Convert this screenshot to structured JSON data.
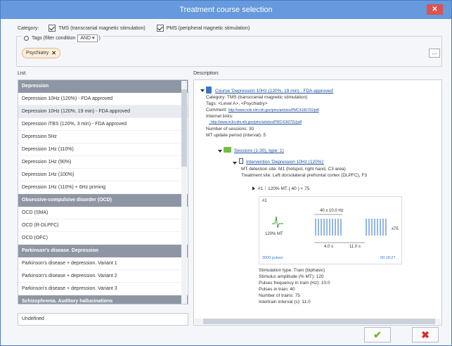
{
  "window": {
    "title": "Treatment course selection"
  },
  "category": {
    "label": "Category:",
    "tms_label": "TMS (transcranial magnetic stimulation)",
    "pms_label": "PMS (peripheral magnetic stimulation)"
  },
  "tags": {
    "label": "Tags (filter condition",
    "condition": "AND",
    "suffix": ")",
    "chip": "Psychiatry",
    "more_button": "..."
  },
  "list": {
    "label": "List:",
    "undefined_item": "Undefined",
    "rows": [
      {
        "type": "header",
        "text": "Depression"
      },
      {
        "type": "item",
        "text": "Depression 10Hz (120%) - FDA approved"
      },
      {
        "type": "item",
        "text": "Depression 10Hz (120%, 19 min) - FDA approved",
        "selected": true
      },
      {
        "type": "item",
        "text": "Depression iTBS (120%, 3 min) - FDA approved"
      },
      {
        "type": "item",
        "text": "Depression 5Hz"
      },
      {
        "type": "item",
        "text": "Depression 1Hz (110%)"
      },
      {
        "type": "item",
        "text": "Depression 1Hz (90%)"
      },
      {
        "type": "item",
        "text": "Depression 1Hz (100%)"
      },
      {
        "type": "item",
        "text": "Depression 1Hz (110%) + 6Hz priming"
      },
      {
        "type": "header",
        "text": "Obsessive-compulsive disorder (OCD)"
      },
      {
        "type": "item",
        "text": "OCD (SMA)"
      },
      {
        "type": "item",
        "text": "OCD (R-DLPFC)"
      },
      {
        "type": "item",
        "text": "OCD (OFC)"
      },
      {
        "type": "header",
        "text": "Parkinson's disease. Depression"
      },
      {
        "type": "item",
        "text": "Parkinson's disease + depression. Variant 1"
      },
      {
        "type": "item",
        "text": "Parkinson's disease + depression. Variant 2"
      },
      {
        "type": "item",
        "text": "Parkinson's disease + depression. Variant 3"
      },
      {
        "type": "header",
        "text": "Schizophrenia. Auditory hallucinations"
      }
    ]
  },
  "description": {
    "label": "Description:",
    "course_title": "Course 'Depression 10Hz (120%, 19 min) - FDA approved'",
    "category_line": "Category: TMS (transcranial magnetic stimulation)",
    "tags_line": "Tags: <Level A>, <Psychiatry>",
    "comment_label": "Comment:",
    "comment_link": "http://www.ncbi.nlm.nih.gov/pmc/articles/PMC4160791/pdf",
    "internet_label": "Internet links:",
    "internet_link": "- http://www.ncbi.nlm.nih.gov/pmc/articles/PMC4160791/pdf",
    "sessions_count": "Number of sessions: 30",
    "mt_update": "MT update period (interval): 5",
    "sessions_link": "Sessions (1-30), type: 1)",
    "intervention_link": "Intervention 'Depression 10Hz (120%)'",
    "mt_detection": "MT detection site: M1 (hotspot, right hand, C3 area)",
    "treatment_site": "Treatment site: Left dorsolateral prefrontal cortex (DLPFC), F3",
    "protocol_line": "#1 ⁴⁰⁰ 120% MT ( 40 ¹⁰·⁰ ʰᶻ ¹¹·⁰ ˢ ) × 75",
    "protocol_hash": "#1",
    "protocol_mt": "120% MT",
    "protocol_formula": "( 40",
    "protocol_repeat": ") × 75",
    "diagram": {
      "label_id": "#1",
      "mt": "120% MT",
      "freq": "40 x 10.0 Hz",
      "repeat": "x75",
      "train_dur": "4.0 s",
      "interval_dur": "11.0 s",
      "pulses": "3000 pulses",
      "time": "00:18:27"
    },
    "params": [
      "Stimulation type: Train (biphasic)",
      "Stimulus amplitude (% MT): 120",
      "Pulses frequency in train (Hz): 10.0",
      "Pulses in train: 40",
      "Number of trains: 75",
      "Intertrain interval (s): 11.0"
    ]
  },
  "buttons": {
    "ok": "✔",
    "cancel": "✖"
  }
}
